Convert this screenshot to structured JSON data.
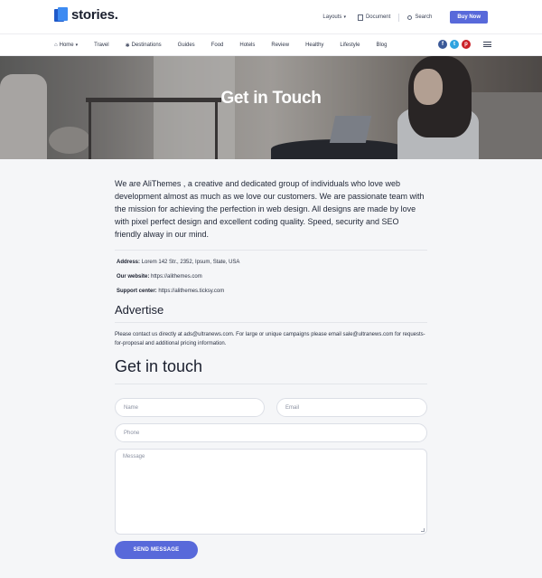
{
  "brand": {
    "name": "stories."
  },
  "header": {
    "layouts_label": "Layouts",
    "document_label": "Document",
    "search_label": "Search",
    "buy_label": "Buy Now"
  },
  "nav": {
    "items": [
      {
        "label": "Home",
        "icon": "home-icon",
        "has_dropdown": true
      },
      {
        "label": "Travel"
      },
      {
        "label": "Destinations",
        "icon": "compass-icon"
      },
      {
        "label": "Guides"
      },
      {
        "label": "Food"
      },
      {
        "label": "Hotels"
      },
      {
        "label": "Review"
      },
      {
        "label": "Healthy"
      },
      {
        "label": "Lifestyle"
      },
      {
        "label": "Blog"
      }
    ],
    "socials": [
      {
        "letter": "f",
        "icon": "facebook-icon",
        "color": "#3b5998"
      },
      {
        "letter": "t",
        "icon": "twitter-icon",
        "color": "#2ea3e0"
      },
      {
        "letter": "p",
        "icon": "pinterest-icon",
        "color": "#cb2027"
      }
    ]
  },
  "hero": {
    "title": "Get in Touch"
  },
  "about": {
    "text": "We are AliThemes , a creative and dedicated group of individuals who love web development almost as much as we love our customers. We are passionate team with the mission for achieving the perfection in web design. All designs are made by love with pixel perfect design and excellent coding quality. Speed, security and SEO friendly alway in our mind.",
    "address_label": "Address:",
    "address_value": "Lorem 142 Str., 2352, Ipsum, State, USA",
    "website_label": "Our website:",
    "website_value": "https://alithemes.com",
    "support_label": "Support center:",
    "support_value": "https://alithemes.ticksy.com"
  },
  "advertise": {
    "title": "Advertise",
    "text": "Please contact us directly at ads@ultranews.com. For large or unique campaigns please email sale@ultranews.com for requests-for-proposal and additional pricing information."
  },
  "form": {
    "title": "Get in touch",
    "name_placeholder": "Name",
    "email_placeholder": "Email",
    "phone_placeholder": "Phone",
    "message_placeholder": "Message",
    "submit_label": "SEND MESSAGE"
  },
  "colors": {
    "accent": "#5869da",
    "page_bg": "#f5f6f8",
    "text": "#1e2532"
  }
}
